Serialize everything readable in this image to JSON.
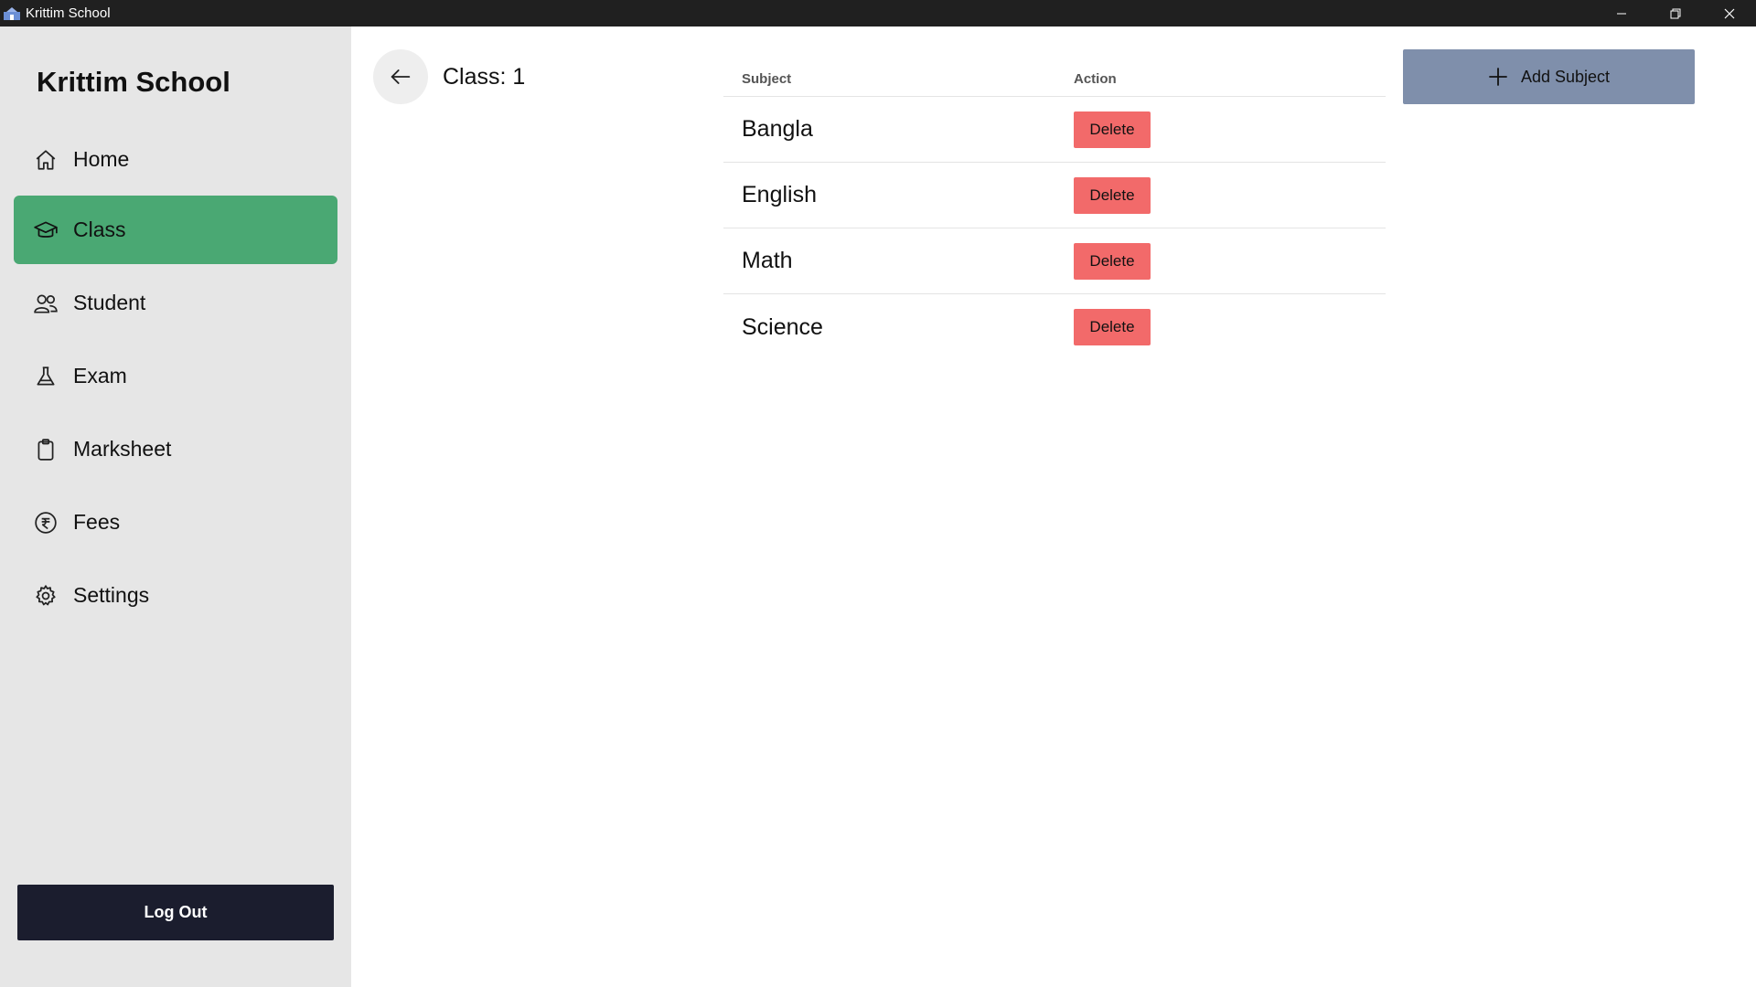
{
  "window": {
    "title": "Krittim School"
  },
  "sidebar": {
    "brand": "Krittim School",
    "items": [
      {
        "label": "Home",
        "icon": "home-icon",
        "active": false
      },
      {
        "label": "Class",
        "icon": "graduation-cap-icon",
        "active": true
      },
      {
        "label": "Student",
        "icon": "users-icon",
        "active": false
      },
      {
        "label": "Exam",
        "icon": "flask-icon",
        "active": false
      },
      {
        "label": "Marksheet",
        "icon": "clipboard-icon",
        "active": false
      },
      {
        "label": "Fees",
        "icon": "rupee-circle-icon",
        "active": false
      },
      {
        "label": "Settings",
        "icon": "gear-icon",
        "active": false
      }
    ],
    "logout_label": "Log Out"
  },
  "main": {
    "title": "Class: 1",
    "table": {
      "headers": {
        "subject": "Subject",
        "action": "Action"
      },
      "rows": [
        {
          "subject": "Bangla",
          "action": "Delete"
        },
        {
          "subject": "English",
          "action": "Delete"
        },
        {
          "subject": "Math",
          "action": "Delete"
        },
        {
          "subject": "Science",
          "action": "Delete"
        }
      ]
    },
    "add_button_label": "Add Subject"
  },
  "colors": {
    "active_nav": "#4aa873",
    "delete": "#f26a6a",
    "add_button": "#7f8fab",
    "logout": "#1b1d2e",
    "sidebar_bg": "#e6e6e6"
  }
}
